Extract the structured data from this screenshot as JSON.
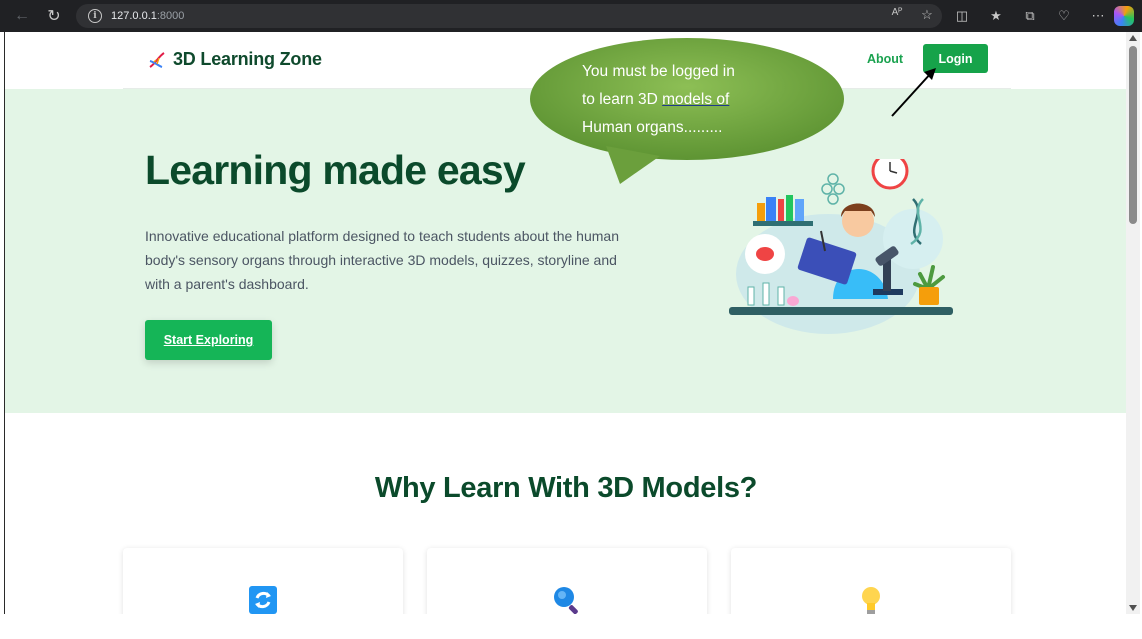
{
  "browser": {
    "url_host": "127.0.0.1",
    "url_port": ":8000",
    "read_aloud_label": "Aᴾ"
  },
  "header": {
    "brand": "3D Learning Zone",
    "nav_about": "About",
    "nav_login": "Login"
  },
  "hero": {
    "title": "Learning made easy",
    "description": "Innovative educational platform designed to teach students about the human body's sensory organs through interactive 3D models, quizzes, storyline and with a parent's dashboard.",
    "cta": "Start Exploring"
  },
  "annotation": {
    "line1": "You must be logged in",
    "line2_pre": "to learn 3D ",
    "line2_underlined": "models  of",
    "line3": "Human  organs.........",
    "bubble_color": "#7cae44"
  },
  "why": {
    "title": "Why Learn With 3D Models?",
    "cards": [
      {
        "icon": "refresh-icon"
      },
      {
        "icon": "magnifier-icon"
      },
      {
        "icon": "lightbulb-icon"
      }
    ]
  },
  "colors": {
    "brand_dark": "#0b4a2b",
    "accent": "#16a34a",
    "hero_bg": "#e3f5e6"
  }
}
